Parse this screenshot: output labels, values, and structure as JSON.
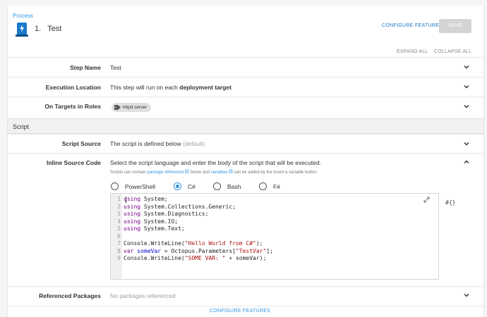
{
  "breadcrumb": "Process",
  "header": {
    "step_number": "1.",
    "title": "Test",
    "configure_features": "CONFIGURE FEATURES",
    "save": "SAVE",
    "expand_all": "EXPAND ALL",
    "collapse_all": "COLLAPSE ALL"
  },
  "rows": {
    "step_name": {
      "label": "Step Name",
      "value": "Test"
    },
    "execution_location": {
      "label": "Execution Location",
      "value_prefix": "This step will run on each ",
      "value_bold": "deployment target"
    },
    "targets_roles": {
      "label": "On Targets in Roles",
      "chip": "httpd server"
    }
  },
  "section": {
    "title": "Script"
  },
  "script_source": {
    "label": "Script Source",
    "value": "The script is defined below",
    "muted": "(default)"
  },
  "inline_source": {
    "label": "Inline Source Code",
    "description": "Select the script language and enter the body of the script that will be executed.",
    "helper_1": "Scripts can contain ",
    "helper_link1": "package references",
    "helper_2": " below and ",
    "helper_link2": "variables",
    "helper_3": " can be added by the ",
    "helper_italic": "Insert a variable",
    "helper_4": " button.",
    "languages": [
      "PowerShell",
      "C#",
      "Bash",
      "F#"
    ],
    "selected_language": "C#",
    "insert_variable": "#{}",
    "line_numbers": [
      "1",
      "2",
      "3",
      "4",
      "5",
      "6",
      "7",
      "8",
      "9"
    ]
  },
  "referenced_packages": {
    "label": "Referenced Packages",
    "value": "No packages referenced"
  },
  "footer": {
    "configure_features": "CONFIGURE FEATURES"
  },
  "colors": {
    "accent": "#2f93e0",
    "save_disabled": "#d4d4d4",
    "section_bg": "#f1f1f1"
  },
  "icons": [
    "step-script-icon",
    "chevron-down-icon",
    "chevron-up-icon",
    "tag-icon",
    "external-link-icon",
    "expand-editor-icon"
  ]
}
